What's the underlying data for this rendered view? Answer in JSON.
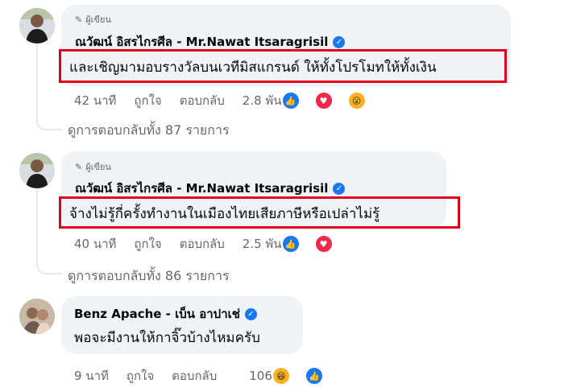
{
  "colors": {
    "bubble": "#f0f2f5",
    "highlight": "#e0001b",
    "like": "#1877f2",
    "love": "#f0284a",
    "emoji": "#f7b125",
    "meta_text": "#65676b"
  },
  "comments": [
    {
      "author_badge": "ผู้เขียน",
      "author": "ณวัฒน์ อิสรไกรศีล - Mr.Nawat Itsaragrisil",
      "verified": true,
      "text": "และเชิญมามอบรางวัลบนเวทีมิสแกรนด์ ให้ทั้งโปรโมทให้ทั้งเงิน",
      "highlighted": true,
      "time": "42 นาที",
      "like_label": "ถูกใจ",
      "reply_label": "ตอบกลับ",
      "reaction_count": "2.8 พัน",
      "reactions": [
        "like-icon",
        "love-icon",
        "wow-icon"
      ],
      "view_replies": "ดูการตอบกลับทั้ง 87 รายการ"
    },
    {
      "author_badge": "ผู้เขียน",
      "author": "ณวัฒน์ อิสรไกรศีล - Mr.Nawat Itsaragrisil",
      "verified": true,
      "text": "จ้างไม่รู้กี่ครั้งทำงานในเมืองไทยเสียภาษีหรือเปล่าไม่รู้",
      "highlighted": true,
      "time": "40 นาที",
      "like_label": "ถูกใจ",
      "reply_label": "ตอบกลับ",
      "reaction_count": "2.5 พัน",
      "reactions": [
        "like-icon",
        "love-icon"
      ],
      "view_replies": "ดูการตอบกลับทั้ง 86 รายการ"
    },
    {
      "author": "Benz Apache - เบ็น อาปาเช่",
      "verified": true,
      "text": "พอจะมีงานให้กาจิ๊วบ้างไหมครับ",
      "highlighted": false,
      "time": "9 นาที",
      "like_label": "ถูกใจ",
      "reply_label": "ตอบกลับ",
      "reaction_count": "106",
      "reactions": [
        "haha-icon",
        "like-icon"
      ]
    }
  ]
}
